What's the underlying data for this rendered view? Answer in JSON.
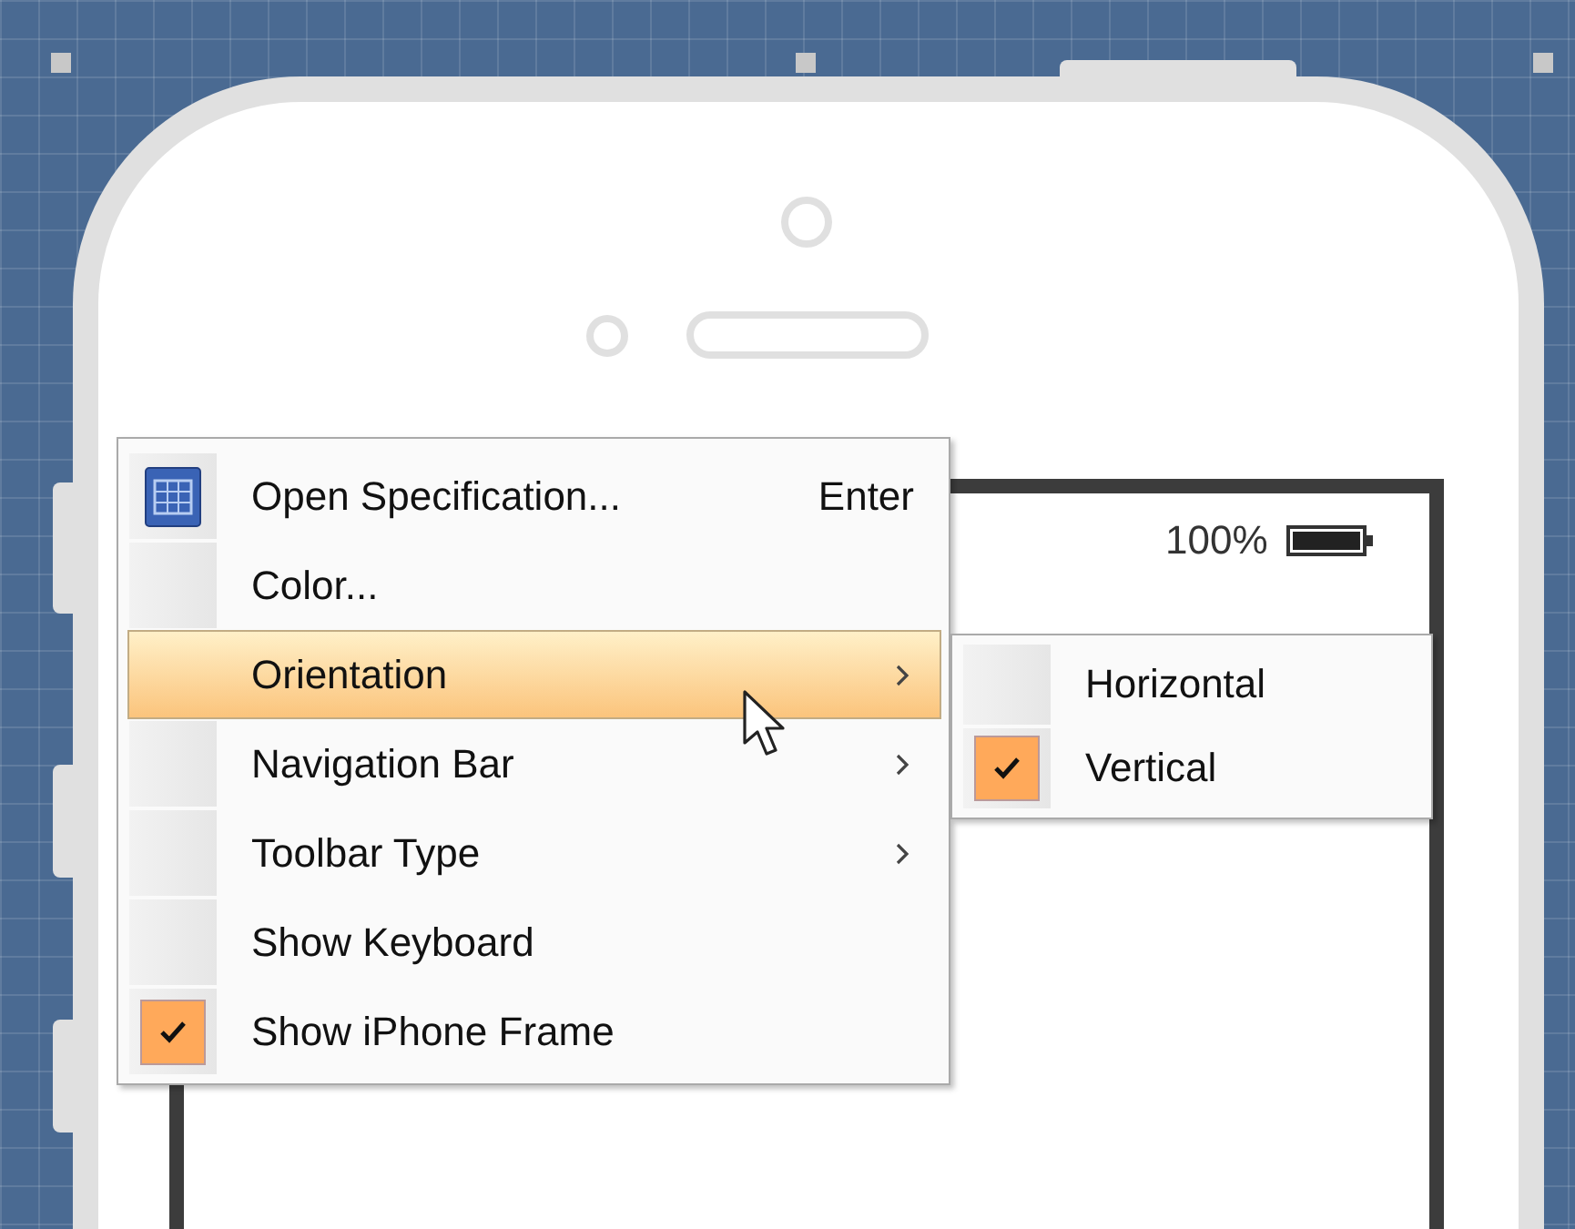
{
  "status_bar": {
    "battery_text": "100%"
  },
  "context_menu": {
    "items": [
      {
        "label": "Open Specification...",
        "shortcut": "Enter",
        "submenu": false,
        "checked": false,
        "selected": false
      },
      {
        "label": "Color...",
        "submenu": false,
        "checked": false,
        "selected": false
      },
      {
        "label": "Orientation",
        "submenu": true,
        "checked": false,
        "selected": true
      },
      {
        "label": "Navigation Bar",
        "submenu": true,
        "checked": false,
        "selected": false
      },
      {
        "label": "Toolbar Type",
        "submenu": true,
        "checked": false,
        "selected": false
      },
      {
        "label": "Show Keyboard",
        "submenu": false,
        "checked": false,
        "selected": false
      },
      {
        "label": "Show iPhone Frame",
        "submenu": false,
        "checked": true,
        "selected": false
      }
    ]
  },
  "submenu": {
    "items": [
      {
        "label": "Horizontal",
        "checked": false,
        "selected": false
      },
      {
        "label": "Vertical",
        "checked": true,
        "selected": false
      }
    ]
  }
}
